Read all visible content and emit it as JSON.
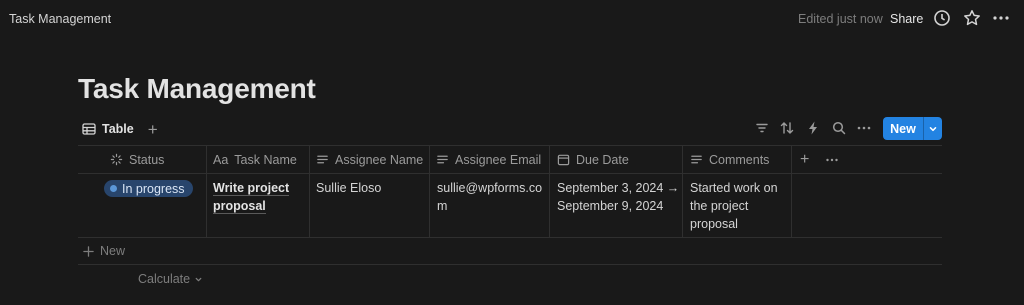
{
  "topbar": {
    "breadcrumb": "Task Management",
    "edited": "Edited just now",
    "share_label": "Share"
  },
  "page": {
    "title": "Task Management"
  },
  "views": {
    "active_tab": "Table",
    "add_symbol": "+"
  },
  "toolbar": {
    "new_label": "New"
  },
  "table": {
    "columns": [
      "Status",
      "Task Name",
      "Assignee Name",
      "Assignee Email",
      "Due Date",
      "Comments"
    ],
    "add_column_symbol": "+",
    "rows": [
      {
        "status": "In progress",
        "task_name_line1": "Write project",
        "task_name_line2": "proposal",
        "assignee_name": "Sullie Eloso",
        "email_line1": "sullie@wpforms.co",
        "email_line2": "m",
        "due_line1": "September 3, 2024 →",
        "due_line2": "September 9, 2024",
        "comment_line1": "Started work on",
        "comment_line2": "the project",
        "comment_line3": "proposal"
      }
    ],
    "new_row_label": "New",
    "calculate_label": "Calculate"
  },
  "colors": {
    "accent": "#2383e2",
    "status_bg": "#28456c",
    "status_dot": "#5b97d8"
  }
}
